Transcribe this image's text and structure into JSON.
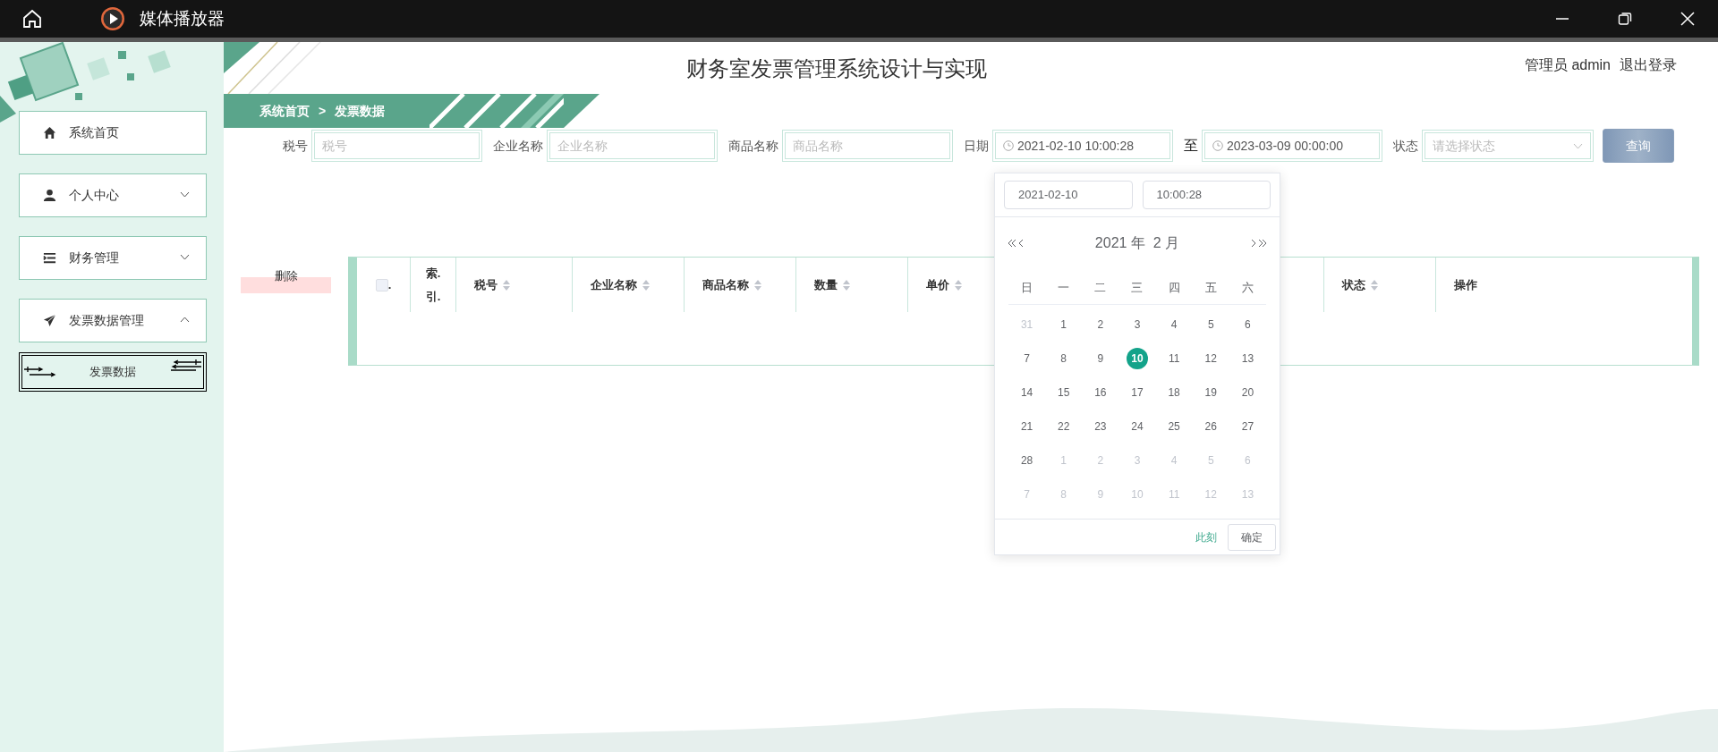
{
  "title_bar": {
    "app_name": "媒体播放器"
  },
  "header": {
    "title": "财务室发票管理系统设计与实现",
    "user": "管理员 admin",
    "logout": "退出登录"
  },
  "sidebar": {
    "items": [
      {
        "label": "系统首页"
      },
      {
        "label": "个人中心",
        "expanded": false
      },
      {
        "label": "财务管理",
        "expanded": false
      },
      {
        "label": "发票数据管理",
        "expanded": true,
        "children": [
          {
            "label": "发票数据",
            "selected": true
          }
        ]
      }
    ]
  },
  "breadcrumb": {
    "items": [
      "系统首页",
      "发票数据"
    ],
    "separator": ">"
  },
  "search": {
    "fields": [
      {
        "kind": "text",
        "label": "税号",
        "placeholder": "税号"
      },
      {
        "kind": "text",
        "label": "企业名称",
        "placeholder": "企业名称"
      },
      {
        "kind": "text",
        "label": "商品名称",
        "placeholder": "商品名称"
      },
      {
        "kind": "date",
        "label": "日期",
        "value": "2021-02-10 10:00:28"
      },
      {
        "kind": "date",
        "label": "至",
        "value": "2023-03-09 00:00:00"
      },
      {
        "kind": "select",
        "label": "状态",
        "placeholder": "请选择状态"
      }
    ],
    "button": "查询"
  },
  "delete_button": "删除",
  "table": {
    "select_all": {
      "checked": false,
      "suffix": "."
    },
    "columns": [
      {
        "label": "索.引.",
        "sortable": false
      },
      {
        "label": "税号",
        "sortable": true
      },
      {
        "label": "企业名称",
        "sortable": true
      },
      {
        "label": "商品名称",
        "sortable": true
      },
      {
        "label": "数量",
        "sortable": true
      },
      {
        "label": "单价",
        "sortable": true
      },
      {
        "label": "状态",
        "sortable": true
      },
      {
        "label": "操作",
        "sortable": false
      }
    ]
  },
  "date_picker": {
    "date_value": "2021-02-10",
    "time_value": "10:00:28",
    "month_label": "2021 年  2 月",
    "weekdays": [
      "日",
      "一",
      "二",
      "三",
      "四",
      "五",
      "六"
    ],
    "days": [
      {
        "label": "31",
        "muted": true,
        "selected": false
      },
      {
        "label": "1",
        "muted": false,
        "selected": false
      },
      {
        "label": "2",
        "muted": false,
        "selected": false
      },
      {
        "label": "3",
        "muted": false,
        "selected": false
      },
      {
        "label": "4",
        "muted": false,
        "selected": false
      },
      {
        "label": "5",
        "muted": false,
        "selected": false
      },
      {
        "label": "6",
        "muted": false,
        "selected": false
      },
      {
        "label": "7",
        "muted": false,
        "selected": false
      },
      {
        "label": "8",
        "muted": false,
        "selected": false
      },
      {
        "label": "9",
        "muted": false,
        "selected": false
      },
      {
        "label": "10",
        "muted": false,
        "selected": true
      },
      {
        "label": "11",
        "muted": false,
        "selected": false
      },
      {
        "label": "12",
        "muted": false,
        "selected": false
      },
      {
        "label": "13",
        "muted": false,
        "selected": false
      },
      {
        "label": "14",
        "muted": false,
        "selected": false
      },
      {
        "label": "15",
        "muted": false,
        "selected": false
      },
      {
        "label": "16",
        "muted": false,
        "selected": false
      },
      {
        "label": "17",
        "muted": false,
        "selected": false
      },
      {
        "label": "18",
        "muted": false,
        "selected": false
      },
      {
        "label": "19",
        "muted": false,
        "selected": false
      },
      {
        "label": "20",
        "muted": false,
        "selected": false
      },
      {
        "label": "21",
        "muted": false,
        "selected": false
      },
      {
        "label": "22",
        "muted": false,
        "selected": false
      },
      {
        "label": "23",
        "muted": false,
        "selected": false
      },
      {
        "label": "24",
        "muted": false,
        "selected": false
      },
      {
        "label": "25",
        "muted": false,
        "selected": false
      },
      {
        "label": "26",
        "muted": false,
        "selected": false
      },
      {
        "label": "27",
        "muted": false,
        "selected": false
      },
      {
        "label": "28",
        "muted": false,
        "selected": false
      },
      {
        "label": "1",
        "muted": true,
        "selected": false
      },
      {
        "label": "2",
        "muted": true,
        "selected": false
      },
      {
        "label": "3",
        "muted": true,
        "selected": false
      },
      {
        "label": "4",
        "muted": true,
        "selected": false
      },
      {
        "label": "5",
        "muted": true,
        "selected": false
      },
      {
        "label": "6",
        "muted": true,
        "selected": false
      },
      {
        "label": "7",
        "muted": true,
        "selected": false
      },
      {
        "label": "8",
        "muted": true,
        "selected": false
      },
      {
        "label": "9",
        "muted": true,
        "selected": false
      },
      {
        "label": "10",
        "muted": true,
        "selected": false
      },
      {
        "label": "11",
        "muted": true,
        "selected": false
      },
      {
        "label": "12",
        "muted": true,
        "selected": false
      },
      {
        "label": "13",
        "muted": true,
        "selected": false
      }
    ],
    "now_link": "此刻",
    "confirm": "确定"
  }
}
